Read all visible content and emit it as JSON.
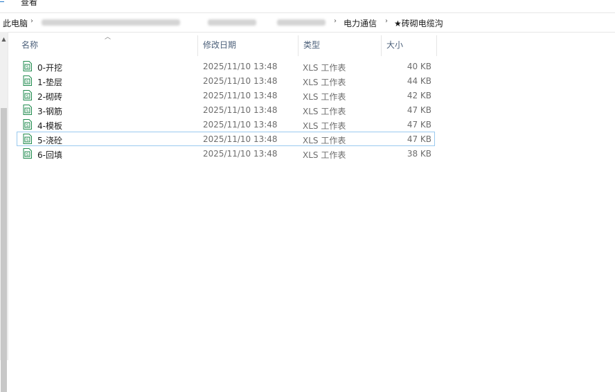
{
  "menu": {
    "view_label": "查看"
  },
  "address_bar": {
    "root": "此电脑",
    "folder_parent": "电力通信",
    "folder_current": "★砖砌电缆沟"
  },
  "columns": {
    "name": "名称",
    "date": "修改日期",
    "type": "类型",
    "size": "大小"
  },
  "files": [
    {
      "name": "0-开挖",
      "date": "2025/11/10 13:48",
      "type": "XLS 工作表",
      "size": "40 KB"
    },
    {
      "name": "1-垫层",
      "date": "2025/11/10 13:48",
      "type": "XLS 工作表",
      "size": "44 KB"
    },
    {
      "name": "2-砌砖",
      "date": "2025/11/10 13:48",
      "type": "XLS 工作表",
      "size": "42 KB"
    },
    {
      "name": "3-钢筋",
      "date": "2025/11/10 13:48",
      "type": "XLS 工作表",
      "size": "47 KB"
    },
    {
      "name": "4-模板",
      "date": "2025/11/10 13:48",
      "type": "XLS 工作表",
      "size": "47 KB"
    },
    {
      "name": "5-浇砼",
      "date": "2025/11/10 13:48",
      "type": "XLS 工作表",
      "size": "47 KB",
      "focused": true
    },
    {
      "name": "6-回填",
      "date": "2025/11/10 13:48",
      "type": "XLS 工作表",
      "size": "38 KB"
    }
  ],
  "colors": {
    "icon_green": "#1e8a4c",
    "focus_border": "#99c9ef",
    "header_text": "#4c607a"
  },
  "icons": {
    "file": "xls-spreadsheet-icon",
    "separator": "chevron-right-icon",
    "sort": "sort-up-icon"
  }
}
